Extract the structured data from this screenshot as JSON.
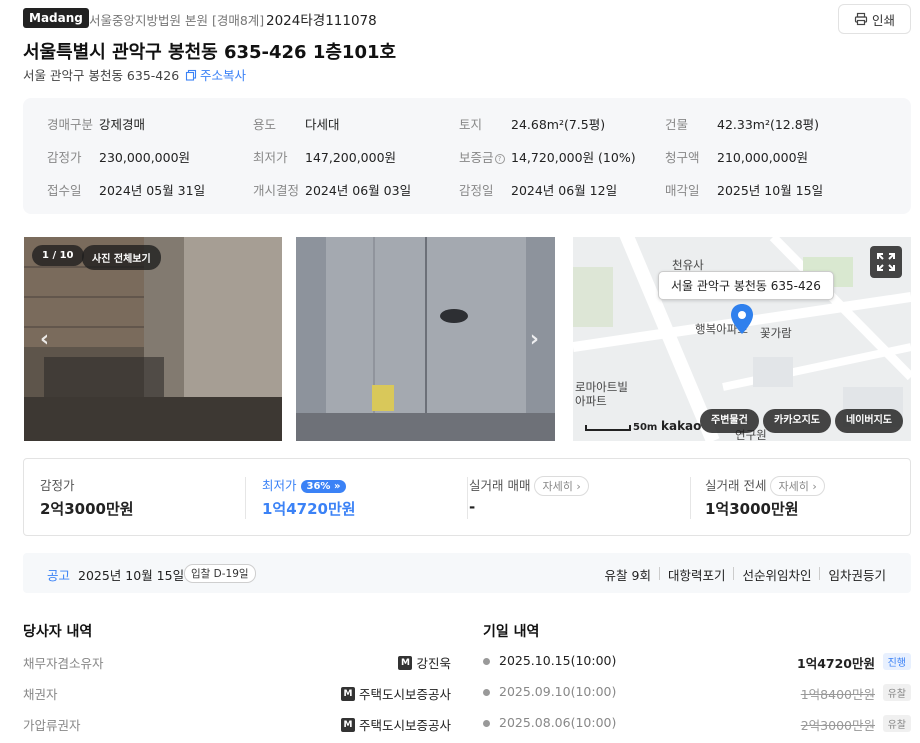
{
  "header": {
    "brand": "Madang",
    "court": "서울중앙지방법원 본원 [경매8계]",
    "case_no": "2024타경111078",
    "print_label": "인쇄",
    "title": "서울특별시 관악구 봉천동 635-426 1층101호",
    "address": "서울 관악구 봉천동 635-426",
    "copy_label": "주소복사"
  },
  "info": {
    "auction_type_label": "경매구분",
    "auction_type": "강제경매",
    "usage_label": "용도",
    "usage": "다세대",
    "land_label": "토지",
    "land": "24.68m²(7.5평)",
    "building_label": "건물",
    "building": "42.33m²(12.8평)",
    "appraisal_label": "감정가",
    "appraisal": "230,000,000원",
    "minimum_label": "최저가",
    "minimum": "147,200,000원",
    "deposit_label": "보증금",
    "deposit": "14,720,000원 (10%)",
    "claim_label": "청구액",
    "claim": "210,000,000원",
    "received_label": "접수일",
    "received": "2024년 05월 31일",
    "commenced_label": "개시결정",
    "commenced": "2024년 06월 03일",
    "appraised_label": "감정일",
    "appraised": "2024년 06월 12일",
    "closing_label": "매각일",
    "closing": "2025년 10월 15일"
  },
  "gallery": {
    "counter": "1 / 10",
    "view_all": "사진 전체보기"
  },
  "map": {
    "marker_label": "서울 관악구 봉천동 635-426",
    "places": [
      "천유사",
      "행복아파트",
      "꽃가람",
      "로마아트빌",
      "아파트",
      "연구원"
    ],
    "scale": "50m",
    "provider": "kakao",
    "buttons": [
      "주변물건",
      "카카오지도",
      "네이버지도"
    ]
  },
  "prices": {
    "appraisal_label": "감정가",
    "appraisal": "2억3000만원",
    "minimum_label": "최저가",
    "minimum_pct": "36%",
    "minimum": "1억4720만원",
    "real_sale_label": "실거래 매매",
    "real_sale": "-",
    "real_lease_label": "실거래 전세",
    "real_lease": "1억3000만원",
    "detail_label": "자세히"
  },
  "notice": {
    "label": "공고",
    "date": "2025년 10월 15일",
    "d_day": "입찰 D-19일",
    "links": [
      "유찰 9회",
      "대항력포기",
      "선순위임차인",
      "임차권등기"
    ]
  },
  "parties": {
    "title": "당사자 내역",
    "rows": [
      {
        "role": "채무자겸소유자",
        "name": "강진욱"
      },
      {
        "role": "채권자",
        "name": "주택도시보증공사"
      },
      {
        "role": "가압류권자",
        "name": "주택도시보증공사"
      }
    ]
  },
  "schedule": {
    "title": "기일 내역",
    "rows": [
      {
        "date": "2025.10.15(10:00)",
        "amount": "1억4720만원",
        "status": "진행"
      },
      {
        "date": "2025.09.10(10:00)",
        "amount": "1억8400만원",
        "status": "유찰"
      },
      {
        "date": "2025.08.06(10:00)",
        "amount": "2억3000만원",
        "status": "유찰"
      }
    ]
  },
  "colors": {
    "accent": "#3b82f6",
    "text": "#222222",
    "muted": "#888888"
  }
}
